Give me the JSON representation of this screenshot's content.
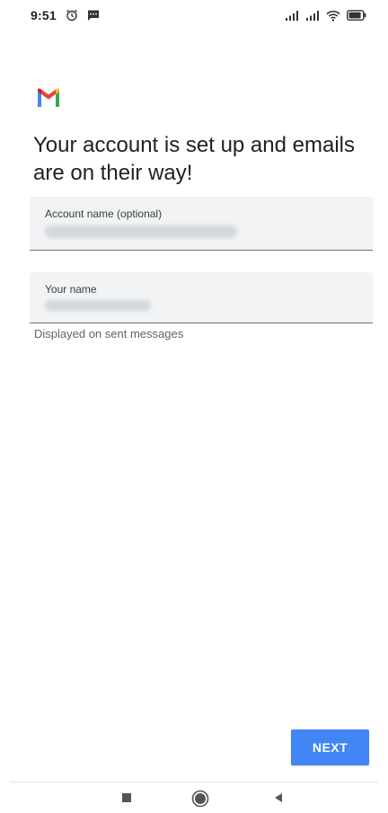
{
  "status_bar": {
    "time": "9:51",
    "icons": [
      "alarm-icon",
      "message-icon",
      "signal-icon",
      "signal-icon",
      "wifi-icon",
      "battery-icon"
    ]
  },
  "app": {
    "logo": "gmail-logo",
    "title": "Your account is set up and emails are on their way!"
  },
  "form": {
    "account_name": {
      "label": "Account name (optional)"
    },
    "your_name": {
      "label": "Your name",
      "helper": "Displayed on sent messages"
    }
  },
  "actions": {
    "next_label": "NEXT"
  },
  "colors": {
    "accent": "#4285f4",
    "field_background": "#f1f3f4",
    "text_primary": "#202124",
    "text_secondary": "#5f6368"
  },
  "nav_bar": {
    "buttons": [
      "recent-apps-button",
      "home-button",
      "back-button"
    ]
  }
}
